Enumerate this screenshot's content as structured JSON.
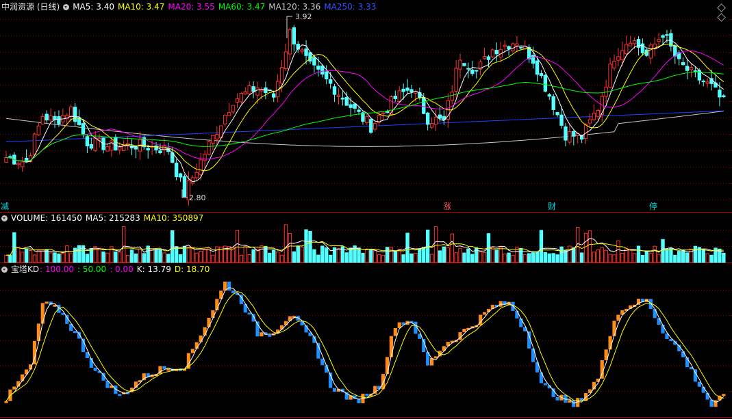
{
  "main_panel": {
    "title": "中润资源 (日线)",
    "ma_labels": [
      {
        "text": "MA5: 3.40",
        "color": "#ffffff"
      },
      {
        "text": "MA10: 3.47",
        "color": "#ffff00"
      },
      {
        "text": "MA20: 3.55",
        "color": "#ff00ff"
      },
      {
        "text": "MA60: 3.47",
        "color": "#00ff00"
      },
      {
        "text": "MA120: 3.36",
        "color": "#c8c8c8"
      },
      {
        "text": "MA250: 3.33",
        "color": "#3355ff"
      }
    ],
    "high_label": "3.92",
    "low_label": "2.80",
    "event_markers": [
      {
        "text": "减",
        "color": "#00dddd"
      },
      {
        "text": "涨",
        "color": "#ff5555"
      },
      {
        "text": "财",
        "color": "#00dddd"
      },
      {
        "text": "停",
        "color": "#00dddd"
      }
    ]
  },
  "volume_panel": {
    "labels": [
      {
        "text": "VOLUME: 161450",
        "color": "#ffffff"
      },
      {
        "text": "MA5: 215283",
        "color": "#ffffff"
      },
      {
        "text": "MA10: 350897",
        "color": "#ffff00"
      }
    ]
  },
  "kd_panel": {
    "name": "宝塔KD",
    "labels": [
      {
        "text": ": 100.00",
        "color": "#ff00ff"
      },
      {
        "text": ": 50.00",
        "color": "#00ff00"
      },
      {
        "text": ": 0.00",
        "color": "#ff00ff"
      },
      {
        "text": "K: 13.79",
        "color": "#ffffff"
      },
      {
        "text": "D: 18.70",
        "color": "#ffff00"
      }
    ]
  },
  "colors": {
    "up": "#ff3232",
    "down": "#54ffff",
    "grid": "#8b0000",
    "kd_up": "#ff8c1a",
    "kd_down": "#1e90ff"
  },
  "chart_data": {
    "type": "candlestick",
    "price_range": [
      2.8,
      3.92
    ],
    "price_anchors": [
      {
        "day": 0,
        "price": 3.05
      },
      {
        "day": 5,
        "price": 3.02
      },
      {
        "day": 9,
        "price": 3.32
      },
      {
        "day": 12,
        "price": 3.28
      },
      {
        "day": 16,
        "price": 3.36
      },
      {
        "day": 20,
        "price": 3.15
      },
      {
        "day": 26,
        "price": 3.12
      },
      {
        "day": 32,
        "price": 3.13
      },
      {
        "day": 40,
        "price": 3.1
      },
      {
        "day": 44,
        "price": 2.82
      },
      {
        "day": 50,
        "price": 3.13
      },
      {
        "day": 56,
        "price": 3.42
      },
      {
        "day": 62,
        "price": 3.5
      },
      {
        "day": 66,
        "price": 3.44
      },
      {
        "day": 70,
        "price": 3.85
      },
      {
        "day": 75,
        "price": 3.63
      },
      {
        "day": 80,
        "price": 3.52
      },
      {
        "day": 86,
        "price": 3.35
      },
      {
        "day": 90,
        "price": 3.25
      },
      {
        "day": 96,
        "price": 3.43
      },
      {
        "day": 100,
        "price": 3.5
      },
      {
        "day": 104,
        "price": 3.3
      },
      {
        "day": 108,
        "price": 3.28
      },
      {
        "day": 112,
        "price": 3.7
      },
      {
        "day": 116,
        "price": 3.6
      },
      {
        "day": 120,
        "price": 3.74
      },
      {
        "day": 126,
        "price": 3.8
      },
      {
        "day": 130,
        "price": 3.68
      },
      {
        "day": 134,
        "price": 3.45
      },
      {
        "day": 138,
        "price": 3.2
      },
      {
        "day": 142,
        "price": 3.18
      },
      {
        "day": 146,
        "price": 3.37
      },
      {
        "day": 150,
        "price": 3.7
      },
      {
        "day": 154,
        "price": 3.82
      },
      {
        "day": 158,
        "price": 3.7
      },
      {
        "day": 162,
        "price": 3.85
      },
      {
        "day": 166,
        "price": 3.65
      },
      {
        "day": 170,
        "price": 3.57
      },
      {
        "day": 174,
        "price": 3.5
      },
      {
        "day": 177,
        "price": 3.4
      }
    ],
    "kd_anchors": [
      {
        "day": 0,
        "k": 10
      },
      {
        "day": 6,
        "k": 35
      },
      {
        "day": 9,
        "k": 80
      },
      {
        "day": 13,
        "k": 75
      },
      {
        "day": 17,
        "k": 58
      },
      {
        "day": 22,
        "k": 30
      },
      {
        "day": 28,
        "k": 12
      },
      {
        "day": 33,
        "k": 25
      },
      {
        "day": 38,
        "k": 32
      },
      {
        "day": 44,
        "k": 35
      },
      {
        "day": 50,
        "k": 70
      },
      {
        "day": 54,
        "k": 95
      },
      {
        "day": 58,
        "k": 82
      },
      {
        "day": 62,
        "k": 58
      },
      {
        "day": 66,
        "k": 60
      },
      {
        "day": 70,
        "k": 72
      },
      {
        "day": 76,
        "k": 50
      },
      {
        "day": 80,
        "k": 20
      },
      {
        "day": 86,
        "k": 8
      },
      {
        "day": 92,
        "k": 20
      },
      {
        "day": 96,
        "k": 65
      },
      {
        "day": 100,
        "k": 68
      },
      {
        "day": 104,
        "k": 35
      },
      {
        "day": 108,
        "k": 50
      },
      {
        "day": 112,
        "k": 58
      },
      {
        "day": 116,
        "k": 67
      },
      {
        "day": 120,
        "k": 78
      },
      {
        "day": 124,
        "k": 80
      },
      {
        "day": 128,
        "k": 60
      },
      {
        "day": 132,
        "k": 20
      },
      {
        "day": 136,
        "k": 12
      },
      {
        "day": 140,
        "k": 5
      },
      {
        "day": 146,
        "k": 25
      },
      {
        "day": 150,
        "k": 70
      },
      {
        "day": 154,
        "k": 80
      },
      {
        "day": 158,
        "k": 82
      },
      {
        "day": 162,
        "k": 60
      },
      {
        "day": 166,
        "k": 45
      },
      {
        "day": 170,
        "k": 25
      },
      {
        "day": 174,
        "k": 5
      },
      {
        "day": 177,
        "k": 12
      }
    ]
  }
}
